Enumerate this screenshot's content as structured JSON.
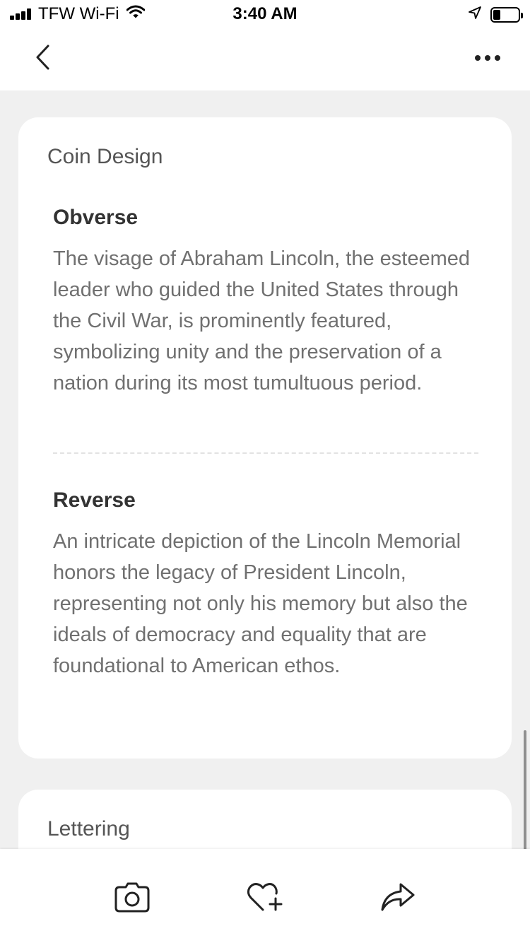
{
  "status_bar": {
    "carrier": "TFW Wi-Fi",
    "time": "3:40 AM"
  },
  "nav": {
    "back_icon": "chevron-left-icon",
    "more_icon": "ellipsis-icon"
  },
  "card": {
    "title": "Coin Design",
    "sections": [
      {
        "heading": "Obverse",
        "body": "The visage of Abraham Lincoln, the esteemed leader who guided the United States through the Civil War, is prominently featured, symbolizing unity and the preservation of a nation during its most tumultuous period."
      },
      {
        "heading": "Reverse",
        "body": "An intricate depiction of the Lincoln Memorial honors the legacy of President Lincoln, representing not only his memory but also the ideals of democracy and equality that are foundational to American ethos."
      }
    ]
  },
  "next_card": {
    "title": "Lettering"
  },
  "toolbar": {
    "icons": [
      "camera-icon",
      "heart-plus-icon",
      "share-icon"
    ]
  },
  "colors": {
    "background": "#f0f0f0",
    "card": "#ffffff",
    "heading": "#333333",
    "body_text": "#707070"
  }
}
